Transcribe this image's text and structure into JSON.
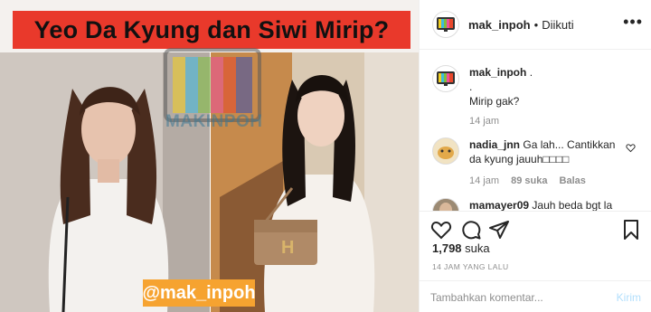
{
  "media": {
    "banner_text": "Yeo Da Kyung dan Siwi Mirip?",
    "watermark_text": "MAKINPOH",
    "handle_tag": "@mak_inpoh"
  },
  "header": {
    "username": "mak_inpoh",
    "separator": "•",
    "follow_status": "Diikuti",
    "more_icon": "more-horizontal-icon"
  },
  "caption": {
    "username": "mak_inpoh",
    "line1": ".",
    "line2": ".",
    "line3": "Mirip gak?",
    "time": "14 jam"
  },
  "comments": [
    {
      "username": "nadia_jnn",
      "text": "Ga lah... Cantikkan da kyung jauuh□□□□",
      "time": "14 jam",
      "likes": "89 suka",
      "reply": "Balas"
    },
    {
      "username": "mamayer09",
      "text": "Jauh beda bgt la"
    }
  ],
  "actions": {
    "likes_count": "1,798",
    "likes_label": "suka",
    "timestamp": "14 JAM YANG LALU"
  },
  "comment_box": {
    "placeholder": "Tambahkan komentar...",
    "post_label": "Kirim"
  },
  "colors": {
    "banner_red": "#e9392b",
    "handle_orange": "#f6a330",
    "post_disabled": "#b2dffc",
    "meta_gray": "#8e8e8e"
  }
}
